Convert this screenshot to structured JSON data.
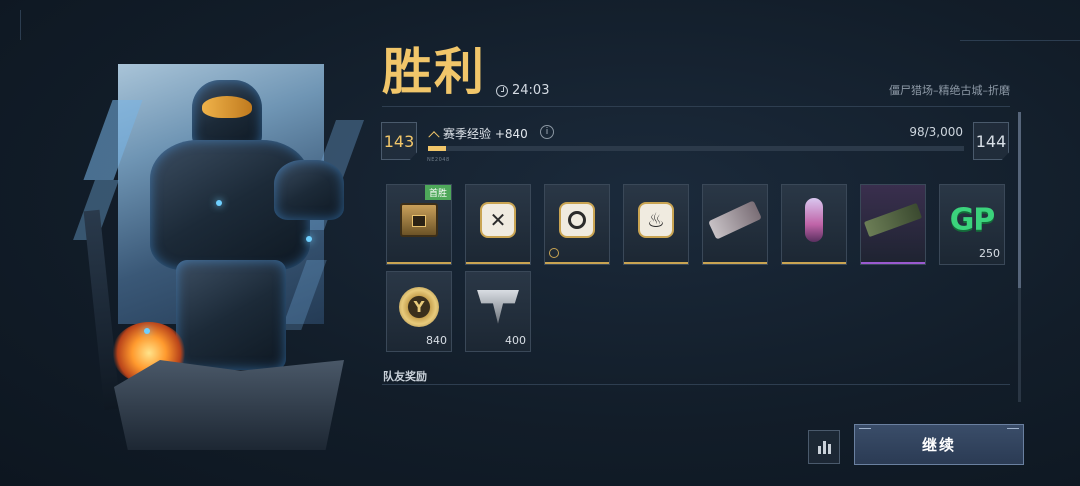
{
  "header": {
    "title": "胜利",
    "timer": "24:03",
    "map_name": "僵尸猎场–精绝古城–折磨"
  },
  "progress": {
    "current_level": "143",
    "next_level": "144",
    "xp_label": "赛季经验 +840",
    "xp_count": "98/3,000",
    "xp_fraction": 0.033,
    "info_glyph": "i",
    "tick_label": "NE2048"
  },
  "rewards": [
    {
      "icon": "crate-icon",
      "badge": "首胜",
      "qty": ""
    },
    {
      "icon": "crossed-tools-icon",
      "badge": "",
      "qty": ""
    },
    {
      "icon": "ring-emblem-icon",
      "badge": "",
      "qty": ""
    },
    {
      "icon": "fountain-emblem-icon",
      "badge": "",
      "qty": ""
    },
    {
      "icon": "weapon-skin-icon",
      "badge": "",
      "qty": ""
    },
    {
      "icon": "pink-charm-icon",
      "badge": "",
      "qty": ""
    },
    {
      "icon": "rifle-icon",
      "badge": "",
      "qty": ""
    },
    {
      "icon": "gp-icon",
      "badge": "",
      "qty": "250",
      "text": "GP"
    },
    {
      "icon": "coin-icon",
      "badge": "",
      "qty": "840"
    },
    {
      "icon": "winged-emblem-icon",
      "badge": "",
      "qty": "400"
    }
  ],
  "teammates_label": "队友奖励",
  "actions": {
    "continue_label": "继续"
  },
  "colors": {
    "accent_gold": "#f1c66a",
    "background": "#121d29",
    "first_win_badge": "#4ea85a"
  }
}
